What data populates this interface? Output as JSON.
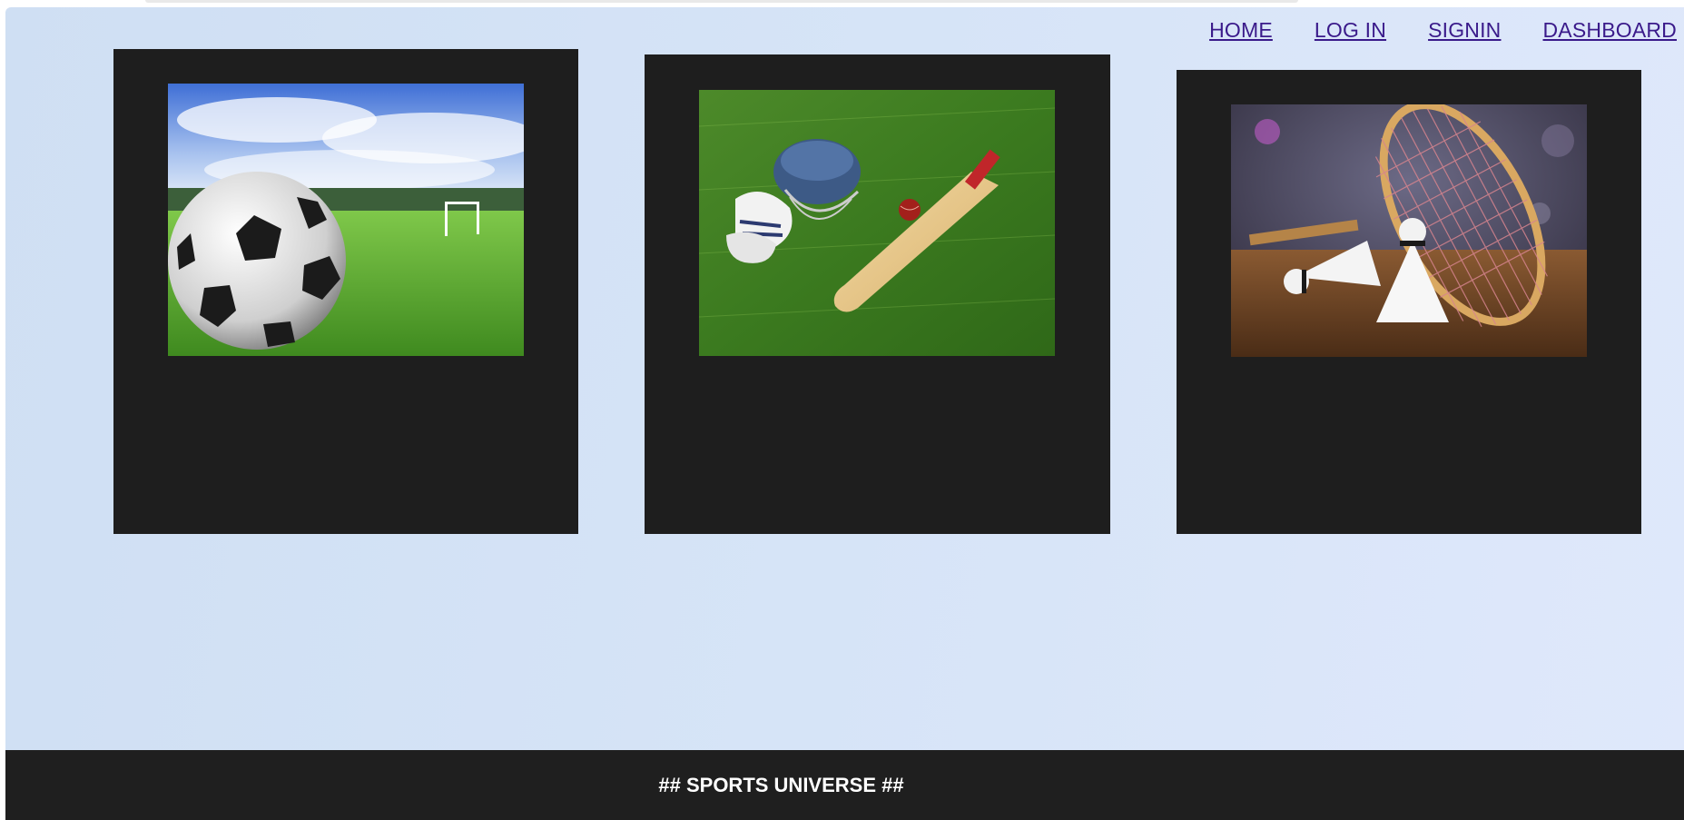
{
  "nav": {
    "items": [
      {
        "label": "HOME"
      },
      {
        "label": "LOG IN"
      },
      {
        "label": "SIGNIN"
      },
      {
        "label": "DASHBOARD"
      }
    ]
  },
  "cards": [
    {
      "image": "soccer-ball-on-grass-field"
    },
    {
      "image": "cricket-bat-helmet-gloves-ball"
    },
    {
      "image": "badminton-racket-and-shuttlecocks"
    }
  ],
  "footer": {
    "text": "## SPORTS UNIVERSE ##"
  },
  "colors": {
    "page_bg": "#d6e4f7",
    "card_bg": "#1e1e1e",
    "footer_bg": "#1f1f1f",
    "link": "#3a1a8a"
  }
}
